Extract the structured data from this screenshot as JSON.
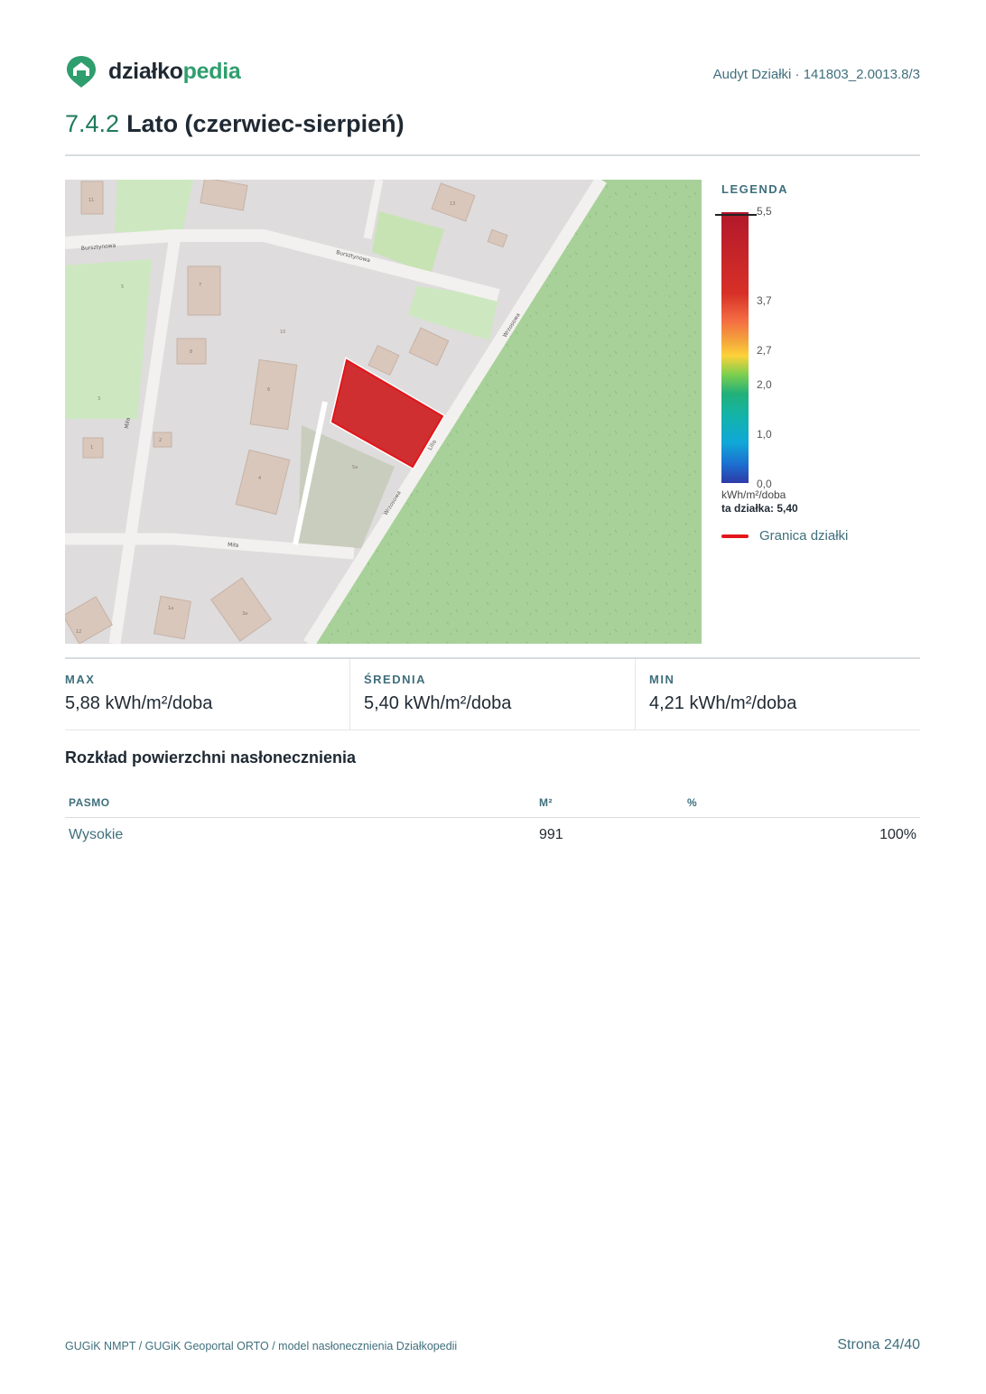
{
  "brand": {
    "name_dark": "działko",
    "name_green": "pedia"
  },
  "header": {
    "audit": "Audyt Działki · 141803_2.0013.8/3"
  },
  "section": {
    "number": "7.4.2",
    "title": "Lato (czerwiec-sierpień)"
  },
  "map": {
    "streets": [
      "Bursztynowa",
      "Bursztynowa",
      "Wrzosowa",
      "Wrzosowa",
      "Miła",
      "Miła",
      "Lilio"
    ],
    "house_numbers": [
      "11",
      "13",
      "7",
      "5",
      "10",
      "8",
      "6",
      "4",
      "3",
      "1",
      "2",
      "12",
      "1a",
      "3a",
      "5a"
    ]
  },
  "legend": {
    "title": "LEGENDA",
    "ticks": [
      "5,5",
      "3,7",
      "2,7",
      "2,0",
      "1,0",
      "0,0"
    ],
    "unit": "kWh/m²/doba",
    "this_plot": "ta działka: 5,40",
    "boundary_label": "Granica działki",
    "colors": {
      "high": "#b2182b",
      "low": "#2d3aa8",
      "boundary": "#e3151a"
    }
  },
  "stats": {
    "max_label": "MAX",
    "max_value": "5,88 kWh/m²/doba",
    "avg_label": "ŚREDNIA",
    "avg_value": "5,40 kWh/m²/doba",
    "min_label": "MIN",
    "min_value": "4,21 kWh/m²/doba"
  },
  "distribution": {
    "title": "Rozkład powierzchni nasłonecznienia",
    "headers": [
      "PASMO",
      "M²",
      "%"
    ],
    "rows": [
      {
        "band": "Wysokie",
        "area": "991",
        "percent": "100%"
      }
    ]
  },
  "footer": {
    "source": "GUGiK NMPT / GUGiK Geoportal ORTO / model nasłonecznienia Działkopedii",
    "page": "Strona 24/40"
  }
}
